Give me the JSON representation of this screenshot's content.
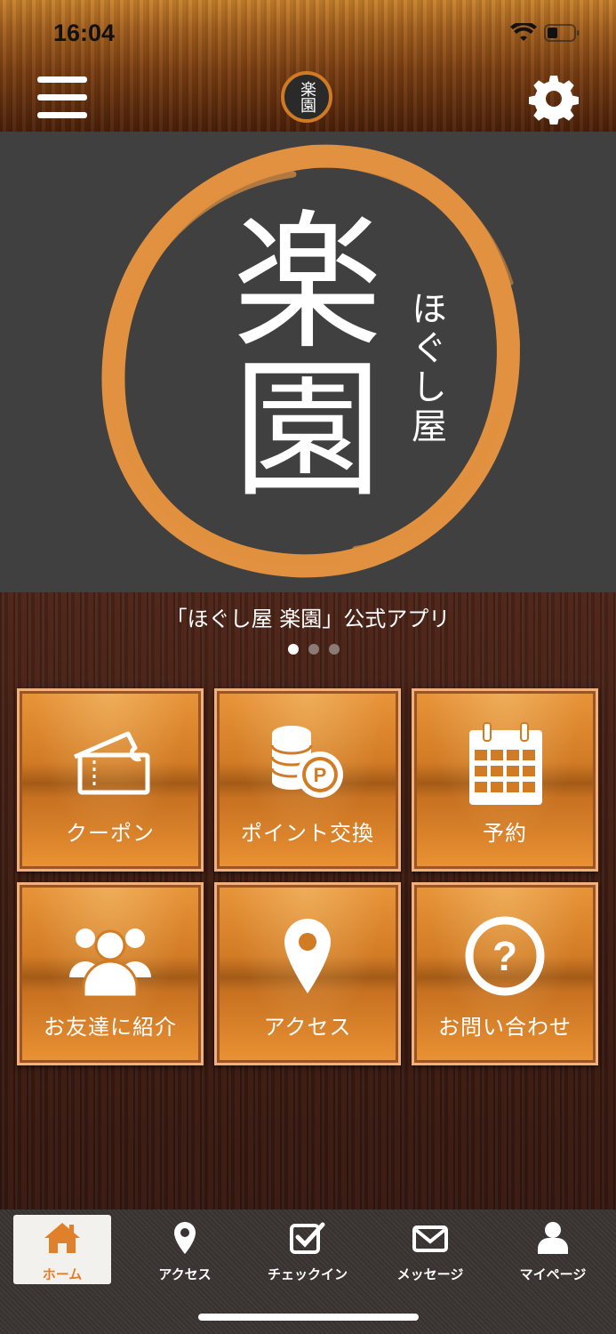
{
  "status": {
    "time": "16:04"
  },
  "header": {
    "logo_text": "楽園",
    "menu_icon": "hamburger-menu-icon",
    "settings_icon": "gear-icon"
  },
  "hero": {
    "brand_main_1": "楽",
    "brand_main_2": "園",
    "brand_sub": "ほぐし屋"
  },
  "caption": "「ほぐし屋 楽園」公式アプリ",
  "carousel": {
    "count": 3,
    "active": 0
  },
  "tiles": [
    {
      "label": "クーポン",
      "icon": "ticket-icon"
    },
    {
      "label": "ポイント交換",
      "icon": "coins-icon"
    },
    {
      "label": "予約",
      "icon": "calendar-icon"
    },
    {
      "label": "お友達に紹介",
      "icon": "users-icon"
    },
    {
      "label": "アクセス",
      "icon": "map-pin-icon"
    },
    {
      "label": "お問い合わせ",
      "icon": "question-icon"
    }
  ],
  "tabbar": [
    {
      "label": "ホーム",
      "icon": "home-icon",
      "active": true
    },
    {
      "label": "アクセス",
      "icon": "map-pin-icon",
      "active": false
    },
    {
      "label": "チェックイン",
      "icon": "checkin-icon",
      "active": false
    },
    {
      "label": "メッセージ",
      "icon": "mail-icon",
      "active": false
    },
    {
      "label": "マイページ",
      "icon": "person-icon",
      "active": false
    }
  ],
  "colors": {
    "accent": "#e0802a",
    "tile_border": "#f1b07c",
    "hero_bg": "#404040",
    "brush": "#e1913f"
  }
}
